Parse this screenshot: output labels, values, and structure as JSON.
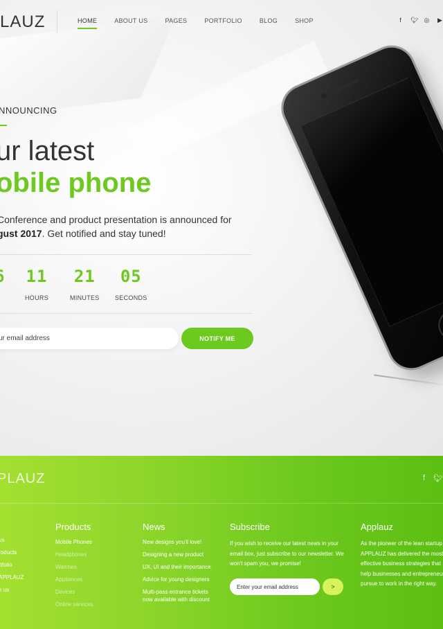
{
  "header": {
    "logo": "LAUZ",
    "nav": [
      "HOME",
      "ABOUT US",
      "PAGES",
      "PORTFOLIO",
      "BLOG",
      "SHOP"
    ],
    "active_nav": "HOME",
    "social_icons": [
      "facebook-icon",
      "twitter-icon",
      "instagram-icon",
      "youtube-icon"
    ]
  },
  "hero": {
    "kicker": "NNOUNCING",
    "title_line1": "ur latest",
    "title_line2": "obile phone",
    "desc_part1": "Conference and product presentation is announced for ",
    "desc_bold": "gust 2017",
    "desc_part2": ". Get notified and stay tuned!",
    "countdown": [
      {
        "num": "6",
        "label": ""
      },
      {
        "num": "11",
        "label": "HOURS"
      },
      {
        "num": "21",
        "label": "MINUTES"
      },
      {
        "num": "05",
        "label": "SECONDS"
      }
    ],
    "email_placeholder": "ur email address",
    "notify_label": "NOTIFY ME"
  },
  "footer": {
    "logo": "PLAUZ",
    "social_icons": [
      "facebook-icon",
      "twitter-icon"
    ],
    "col1_items": [
      "us",
      "roducts",
      "rtfolio",
      "APPLAUZ",
      "e us"
    ],
    "products": {
      "title": "Products",
      "items": [
        "Mobile Phones",
        "Headphones",
        "Watches",
        "Appliances",
        "Devices",
        "Online services"
      ]
    },
    "news": {
      "title": "News",
      "items": [
        "New designs you'll love!",
        "Designing a new product",
        "UX, UI and their importance",
        "Advice for young designers",
        "Multi-pass entrance tickets",
        "now available with discount"
      ]
    },
    "subscribe": {
      "title": "Subscribe",
      "text": "If you wish to receive our latest news in your email box, just subscribe to our newsletter. We won't spam you, we promise!",
      "placeholder": "Enter your email address",
      "button": ">"
    },
    "applauz": {
      "title": "Applauz",
      "text": "As the pioneer of the lean startup APPLAUZ has delivered the most effective business strategies that help businesses and entrepreneurs pursue to work in the right way."
    }
  },
  "colors": {
    "accent": "#6cc91e",
    "footer_gradient_start": "#a4e030",
    "footer_gradient_end": "#5cbf12"
  }
}
